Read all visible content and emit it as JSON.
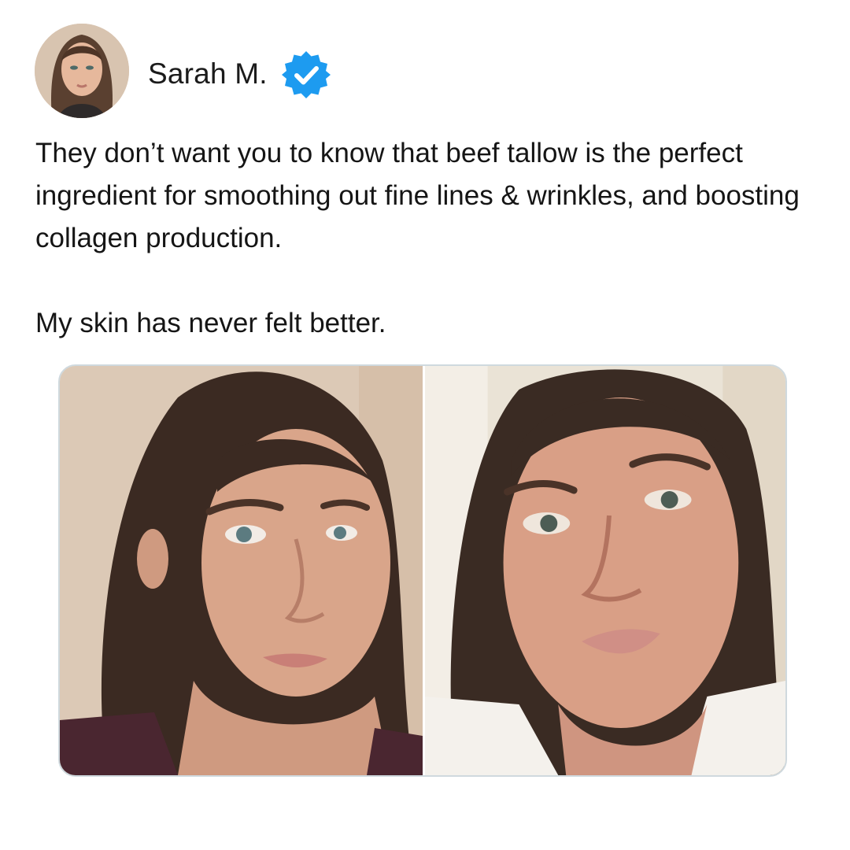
{
  "author": {
    "name": "Sarah M.",
    "verified": true,
    "avatar_icon": "avatar-photo"
  },
  "post": {
    "paragraphs": [
      "They don’t want you to know that beef tallow is the perfect ingredient for smoothing out fine lines & wrinkles, and boosting collagen production.",
      "My skin has never felt better."
    ]
  },
  "media": {
    "images": [
      {
        "name": "face-photo-left"
      },
      {
        "name": "face-photo-right"
      }
    ]
  },
  "colors": {
    "verified_badge": "#1d9bf0",
    "text": "#151515",
    "media_border": "#cfd9de"
  }
}
